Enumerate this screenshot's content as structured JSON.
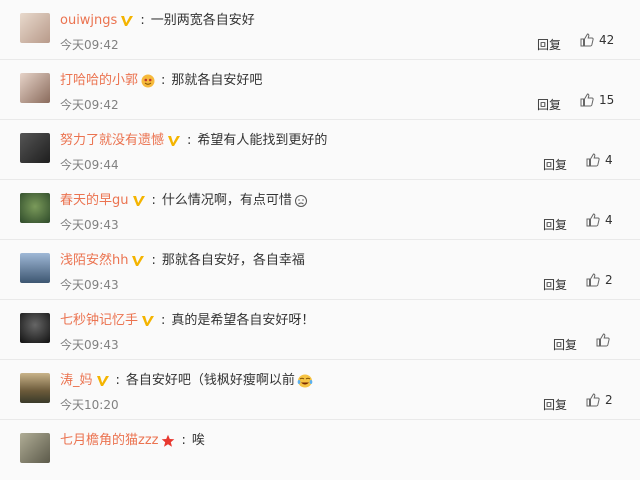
{
  "comments": [
    {
      "user": "ouiwjngs",
      "badge": "v",
      "text": "一别两宽各自安好",
      "time": "今天09:42",
      "reply": "回复",
      "likes": "42",
      "avatar": "#d9c6b8"
    },
    {
      "user": "打哈哈的小郭",
      "badge": "emoji",
      "text": "那就各自安好吧",
      "time": "今天09:42",
      "reply": "回复",
      "likes": "15",
      "avatar": "#b99a8c"
    },
    {
      "user": "努力了就没有遗憾",
      "badge": "v",
      "text": "希望有人能找到更好的",
      "time": "今天09:44",
      "reply": "回复",
      "likes": "4",
      "avatar": "#3a3a3a"
    },
    {
      "user": "春天的早gu",
      "badge": "v",
      "text": "什么情况啊，有点可惜",
      "time": "今天09:43",
      "reply": "回复",
      "likes": "4",
      "avatar": "#5f7f53"
    },
    {
      "user": "浅陌安然hh",
      "badge": "v",
      "text": "那就各自安好，各自幸福",
      "time": "今天09:43",
      "reply": "回复",
      "likes": "2",
      "avatar": "#7d97b5"
    },
    {
      "user": "七秒钟记忆手",
      "badge": "v",
      "text": "真的是希望各自安好呀！",
      "time": "今天09:43",
      "reply": "回复",
      "likes": "",
      "avatar": "#2c2c2c"
    },
    {
      "user": "涛_妈",
      "badge": "v",
      "text": "各自安好吧（钱枫好瘦啊以前",
      "time": "今天10:20",
      "reply": "回复",
      "likes": "2",
      "avatar": "#9a8a6d"
    },
    {
      "user": "七月檐角的猫zzz",
      "badge": "star",
      "text": "唉",
      "time": "",
      "reply": "",
      "likes": "",
      "avatar": "#8c8c7a"
    }
  ],
  "icons": {
    "verified": "v-badge-icon",
    "like": "thumb-up-icon",
    "smile": "smile-emoji-icon",
    "sad": "sad-emoji-icon",
    "star": "star-badge-icon"
  }
}
